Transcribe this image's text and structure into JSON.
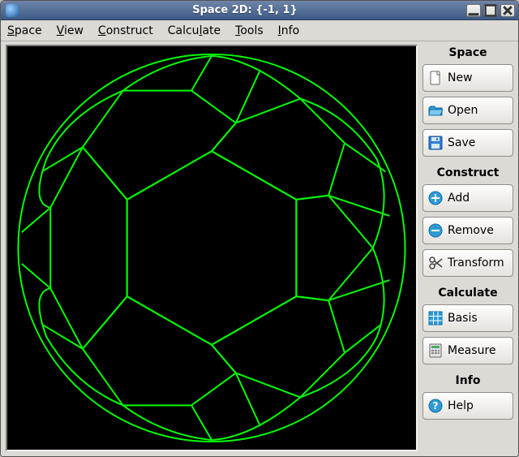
{
  "titlebar": {
    "title": "Space 2D: {-1, 1}"
  },
  "menubar": {
    "items": [
      {
        "label": "Space",
        "accel": "S"
      },
      {
        "label": "View",
        "accel": "V"
      },
      {
        "label": "Construct",
        "accel": "C"
      },
      {
        "label": "Calculate",
        "accel": "l"
      },
      {
        "label": "Tools",
        "accel": "T"
      },
      {
        "label": "Info",
        "accel": "I"
      }
    ]
  },
  "rightpanel": {
    "groups": [
      {
        "title": "Space",
        "buttons": [
          {
            "name": "new-button",
            "icon": "file-new-icon",
            "label": "New"
          },
          {
            "name": "open-button",
            "icon": "folder-open-icon",
            "label": "Open"
          },
          {
            "name": "save-button",
            "icon": "disk-save-icon",
            "label": "Save"
          }
        ]
      },
      {
        "title": "Construct",
        "buttons": [
          {
            "name": "add-button",
            "icon": "plus-circle-icon",
            "label": "Add"
          },
          {
            "name": "remove-button",
            "icon": "minus-circle-icon",
            "label": "Remove"
          },
          {
            "name": "transform-button",
            "icon": "scissors-icon",
            "label": "Transform"
          }
        ]
      },
      {
        "title": "Calculate",
        "buttons": [
          {
            "name": "basis-button",
            "icon": "grid-icon",
            "label": "Basis"
          },
          {
            "name": "measure-button",
            "icon": "calculator-icon",
            "label": "Measure"
          }
        ]
      },
      {
        "title": "Info",
        "buttons": [
          {
            "name": "help-button",
            "icon": "help-icon",
            "label": "Help"
          }
        ]
      }
    ]
  },
  "canvas": {
    "stroke_color": "#00ff00",
    "background": "#000000"
  }
}
